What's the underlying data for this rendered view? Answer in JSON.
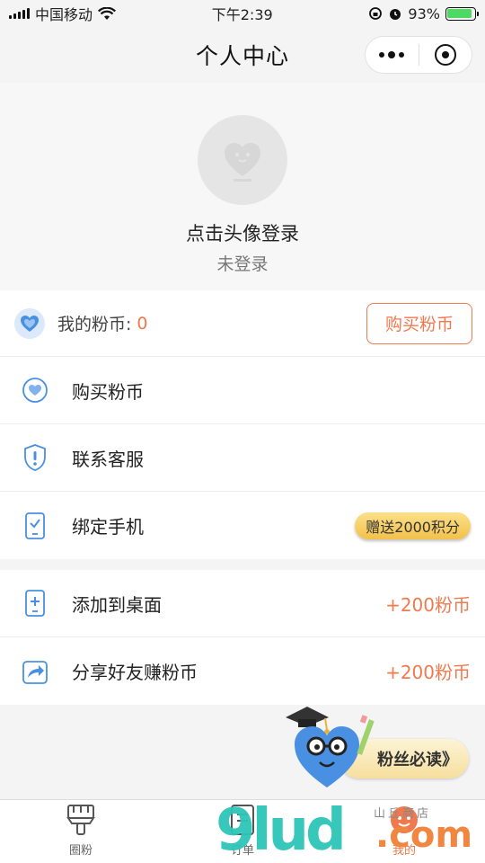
{
  "status_bar": {
    "carrier": "中国移动",
    "time": "下午2:39",
    "battery_percent": "93%",
    "battery_level": 0.93
  },
  "nav": {
    "title": "个人中心"
  },
  "profile": {
    "login_hint": "点击头像登录",
    "login_status": "未登录"
  },
  "coins": {
    "label": "我的粉币:",
    "value": "0",
    "buy_button": "购买粉币"
  },
  "menu_group_1": [
    {
      "label": "购买粉币",
      "icon": "heart-shield-icon"
    },
    {
      "label": "联系客服",
      "icon": "shield-alert-icon"
    },
    {
      "label": "绑定手机",
      "icon": "phone-check-icon",
      "badge": "赠送2000积分"
    }
  ],
  "menu_group_2": [
    {
      "label": "添加到桌面",
      "icon": "phone-add-icon",
      "extra": "+200粉币"
    },
    {
      "label": "分享好友赚粉币",
      "icon": "share-arrow-icon",
      "extra": "+200粉币"
    }
  ],
  "banner": {
    "text": "粉丝必读》"
  },
  "tab_bar": [
    {
      "label": "圈粉",
      "icon": "brush-icon"
    },
    {
      "label": "订单",
      "icon": "order-icon"
    },
    {
      "label": "我的",
      "icon": "profile-icon"
    }
  ],
  "watermark": {
    "main": "9lud",
    "suffix": ".com",
    "small": "山丘商店"
  },
  "colors": {
    "accent": "#f07a4f",
    "icon_blue": "#4a90e2",
    "badge_gold": "#f2c14a"
  }
}
